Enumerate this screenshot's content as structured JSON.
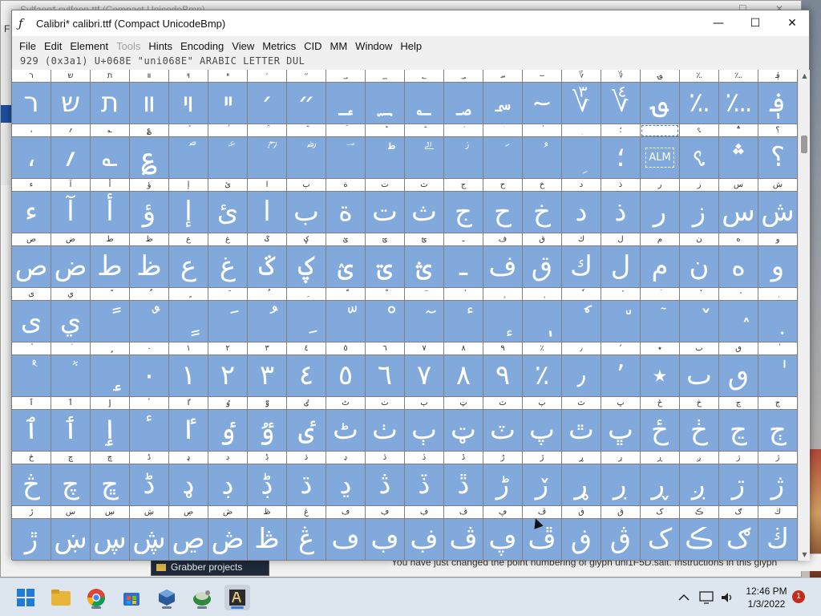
{
  "background_window": {
    "title": "Sylfaen*  sylfaen.ttf (Compact UnicodeBmp)",
    "menu_char": "F"
  },
  "window": {
    "title": "Calibri*  calibri.ttf (Compact UnicodeBmp)",
    "minimize": "—",
    "maximize": "☐",
    "close": "✕"
  },
  "menubar": {
    "items": [
      {
        "label": "File",
        "disabled": false
      },
      {
        "label": "Edit",
        "disabled": false
      },
      {
        "label": "Element",
        "disabled": false
      },
      {
        "label": "Tools",
        "disabled": true
      },
      {
        "label": "Hints",
        "disabled": false
      },
      {
        "label": "Encoding",
        "disabled": false
      },
      {
        "label": "View",
        "disabled": false
      },
      {
        "label": "Metrics",
        "disabled": false
      },
      {
        "label": "CID",
        "disabled": false
      },
      {
        "label": "MM",
        "disabled": false
      },
      {
        "label": "Window",
        "disabled": false
      },
      {
        "label": "Help",
        "disabled": false
      }
    ]
  },
  "infoline": "929 (0x3a1) U+068E \"uni068E\" ARABIC LETTER DUL",
  "grid": {
    "rows": [
      {
        "headers": [
          "ר",
          "ש",
          "ת",
          "װ",
          "ױ",
          "ײ",
          "׳",
          "״",
          "؀",
          "؁",
          "؂",
          "؃",
          "؄",
          "؅",
          "؆",
          "؇",
          "؈",
          "؉",
          "؊",
          "؋"
        ],
        "glyphs": [
          "ר",
          "ש",
          "ת",
          "װ",
          "ױ",
          "ײ",
          "׳",
          "״",
          "؀",
          "؁",
          "؂",
          "؃",
          "؄",
          "؅",
          "؆",
          "؇",
          "؈",
          "؉",
          "؊",
          "؋"
        ]
      },
      {
        "headers": [
          "،",
          "؍",
          "؎",
          "؏",
          "ؐ",
          "ؑ",
          "ؒ",
          "ؓ",
          "ؔ",
          "ؕ",
          "ؖ",
          "ؗ",
          "ؘ",
          "ؙ",
          "ؚ",
          "؛",
          "؜",
          "؝",
          "؞",
          "؟"
        ],
        "glyphs": [
          "،",
          "؍",
          "؎",
          "؏",
          "ؐ",
          "ؑ",
          "ؒ",
          "ؓ",
          "ؔ",
          "ؕ",
          "ؖ",
          "ؗ",
          "ؘ",
          "ؙ",
          "ؚ",
          "؛",
          "ALM",
          "؝",
          "؞",
          "؟"
        ]
      },
      {
        "headers": [
          "ء",
          "آ",
          "أ",
          "ؤ",
          "إ",
          "ئ",
          "ا",
          "ب",
          "ة",
          "ت",
          "ث",
          "ج",
          "ح",
          "خ",
          "د",
          "ذ",
          "ر",
          "ز",
          "س",
          "ش"
        ],
        "glyphs": [
          "ء",
          "آ",
          "أ",
          "ؤ",
          "إ",
          "ئ",
          "ا",
          "ب",
          "ة",
          "ت",
          "ث",
          "ج",
          "ح",
          "خ",
          "د",
          "ذ",
          "ر",
          "ز",
          "س",
          "ش"
        ]
      },
      {
        "headers": [
          "ص",
          "ض",
          "ط",
          "ظ",
          "ع",
          "غ",
          "ػ",
          "ؼ",
          "ؽ",
          "ؾ",
          "ؿ",
          "ـ",
          "ف",
          "ق",
          "ك",
          "ل",
          "م",
          "ن",
          "ه",
          "و"
        ],
        "glyphs": [
          "ص",
          "ض",
          "ط",
          "ظ",
          "ع",
          "غ",
          "ػ",
          "ؼ",
          "ؽ",
          "ؾ",
          "ؿ",
          "ـ",
          "ف",
          "ق",
          "ك",
          "ل",
          "م",
          "ن",
          "ه",
          "و"
        ]
      },
      {
        "headers": [
          "ى",
          "ي",
          "ً",
          "ٌ",
          "ٍ",
          "َ",
          "ُ",
          "ِ",
          "ّ",
          "ْ",
          "ٓ",
          "ٔ",
          "ٕ",
          "ٖ",
          "ٗ",
          "٘",
          "ٙ",
          "ٚ",
          "ٛ",
          "ٜ"
        ],
        "glyphs": [
          "ى",
          "ي",
          "ً",
          "ٌ",
          "ٍ",
          "َ",
          "ُ",
          "ِ",
          "ّ",
          "ْ",
          "ٓ",
          "ٔ",
          "ٕ",
          "ٖ",
          "ٗ",
          "٘",
          "ٙ",
          "ٚ",
          "ٛ",
          "ٜ"
        ]
      },
      {
        "headers": [
          "ٝ",
          "ٞ",
          "ٟ",
          "٠",
          "١",
          "٢",
          "٣",
          "٤",
          "٥",
          "٦",
          "٧",
          "٨",
          "٩",
          "٪",
          "٫",
          "٬",
          "٭",
          "ٮ",
          "ٯ",
          "ٰ"
        ],
        "glyphs": [
          "ٝ",
          "ٞ",
          "ٟ",
          "٠",
          "١",
          "٢",
          "٣",
          "٤",
          "٥",
          "٦",
          "٧",
          "٨",
          "٩",
          "٪",
          "٫",
          "٬",
          "٭",
          "ٮ",
          "ٯ",
          "ٰ"
        ]
      },
      {
        "headers": [
          "ٱ",
          "ٲ",
          "ٳ",
          "ٴ",
          "ٵ",
          "ٶ",
          "ٷ",
          "ٸ",
          "ٹ",
          "ٺ",
          "ٻ",
          "ټ",
          "ٽ",
          "پ",
          "ٿ",
          "ڀ",
          "ځ",
          "ڂ",
          "ڃ",
          "ڄ"
        ],
        "glyphs": [
          "ٱ",
          "ٲ",
          "ٳ",
          "ٴ",
          "ٵ",
          "ٶ",
          "ٷ",
          "ٸ",
          "ٹ",
          "ٺ",
          "ٻ",
          "ټ",
          "ٽ",
          "پ",
          "ٿ",
          "ڀ",
          "ځ",
          "ڂ",
          "ڃ",
          "ڄ"
        ]
      },
      {
        "headers": [
          "څ",
          "چ",
          "ڇ",
          "ڈ",
          "ډ",
          "ڊ",
          "ڋ",
          "ڌ",
          "ڍ",
          "ڎ",
          "ڏ",
          "ڐ",
          "ڑ",
          "ڒ",
          "ړ",
          "ڔ",
          "ڕ",
          "ږ",
          "ڗ",
          "ژ"
        ],
        "glyphs": [
          "څ",
          "چ",
          "ڇ",
          "ڈ",
          "ډ",
          "ڊ",
          "ڋ",
          "ڌ",
          "ڍ",
          "ڎ",
          "ڏ",
          "ڐ",
          "ڑ",
          "ڒ",
          "ړ",
          "ڔ",
          "ڕ",
          "ږ",
          "ڗ",
          "ژ"
        ]
      },
      {
        "headers": [
          "ڙ",
          "ښ",
          "ڛ",
          "ڜ",
          "ڝ",
          "ڞ",
          "ڟ",
          "ڠ",
          "ڡ",
          "ڢ",
          "ڣ",
          "ڤ",
          "ڥ",
          "ڦ",
          "ڧ",
          "ڨ",
          "ک",
          "ڪ",
          "ګ",
          "ڬ"
        ],
        "glyphs": [
          "ڙ",
          "ښ",
          "ڛ",
          "ڜ",
          "ڝ",
          "ڞ",
          "ڟ",
          "ڠ",
          "ڡ",
          "ڢ",
          "ڣ",
          "ڤ",
          "ڥ",
          "ڦ",
          "ڧ",
          "ڨ",
          "ک",
          "ڪ",
          "ګ",
          "ڬ"
        ]
      }
    ],
    "selected": {
      "row": 1,
      "col": 16
    }
  },
  "bg_message": "You have just changed the point numbering of glyph uni1F5D.salt. Instructions in this glyph",
  "bg_panel": "Grabber projects",
  "taskbar": {
    "time": "12:46 PM",
    "date": "1/3/2022",
    "notifications": "1"
  },
  "colors": {
    "glyph_bg": "#82a9dc",
    "accent": "#1a4fa0"
  }
}
